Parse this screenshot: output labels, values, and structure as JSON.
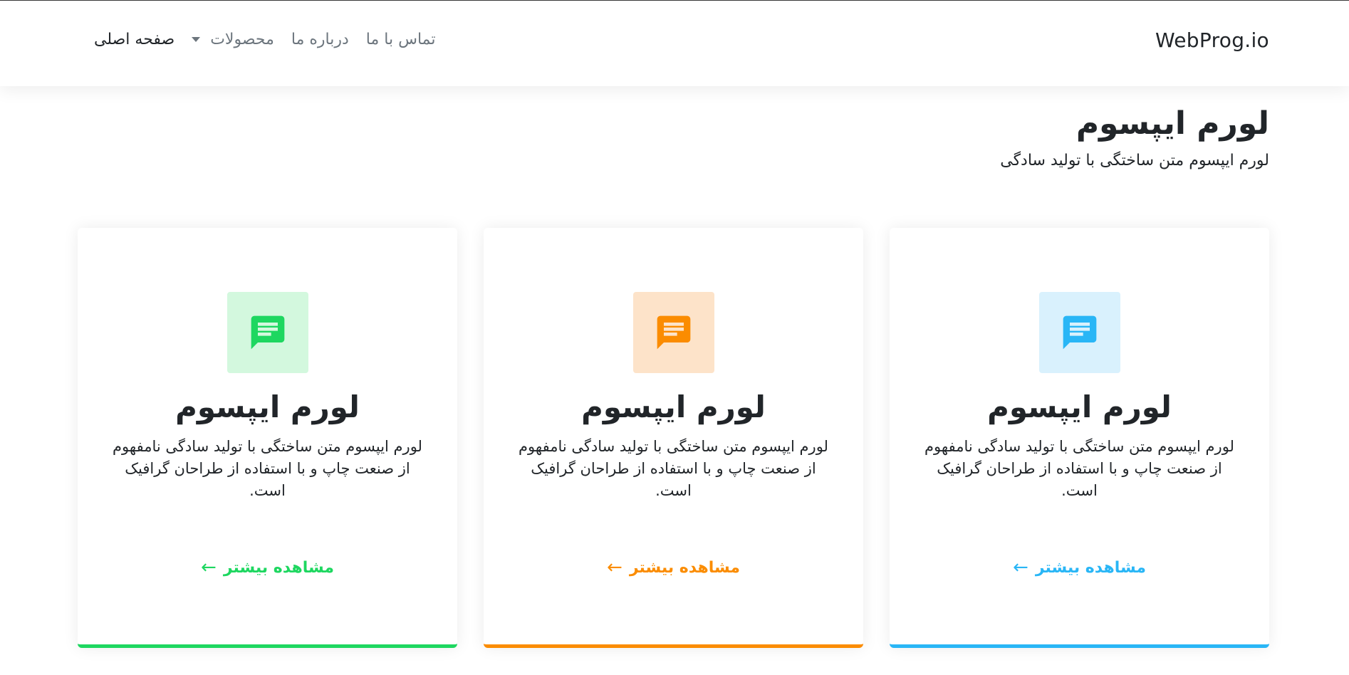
{
  "navbar": {
    "brand": "WebProg.io",
    "items": [
      {
        "label": "صفحه اصلی",
        "active": true
      },
      {
        "label": "محصولات",
        "dropdown": true
      },
      {
        "label": "درباره ما"
      },
      {
        "label": "تماس با ما"
      }
    ]
  },
  "header": {
    "title": "لورم ایپسوم",
    "subtitle": "لورم ایپسوم متن ساختگی با تولید سادگی"
  },
  "cards": [
    {
      "title": "لورم ایپسوم",
      "text": "لورم ایپسوم متن ساختگی با تولید سادگی نامفهوم از صنعت چاپ و با استفاده از طراحان گرافیک است.",
      "link_label": "مشاهده بیشتر",
      "arrow": "←",
      "icon": "message-icon",
      "accent": "#29b6f6",
      "icon_bg": "#d9f1fd"
    },
    {
      "title": "لورم ایپسوم",
      "text": "لورم ایپسوم متن ساختگی با تولید سادگی نامفهوم از صنعت چاپ و با استفاده از طراحان گرافیک است.",
      "link_label": "مشاهده بیشتر",
      "arrow": "←",
      "icon": "message-icon",
      "accent": "#fb8c00",
      "icon_bg": "#fde3c9"
    },
    {
      "title": "لورم ایپسوم",
      "text": "لورم ایپسوم متن ساختگی با تولید سادگی نامفهوم از صنعت چاپ و با استفاده از طراحان گرافیک است.",
      "link_label": "مشاهده بیشتر",
      "arrow": "←",
      "icon": "message-icon",
      "accent": "#1ed760",
      "icon_bg": "#d3f8de"
    }
  ]
}
